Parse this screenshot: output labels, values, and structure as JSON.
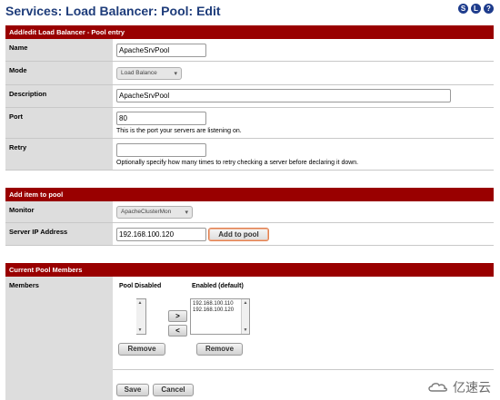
{
  "page": {
    "title": "Services: Load Balancer: Pool: Edit",
    "header_icons": [
      {
        "name": "status-icon",
        "glyph": "S"
      },
      {
        "name": "log-icon",
        "glyph": "L"
      },
      {
        "name": "help-icon",
        "glyph": "?"
      }
    ]
  },
  "colors": {
    "section_header": "#990000",
    "title": "#1e3c7a",
    "label_bg": "#dddddd"
  },
  "pool_entry": {
    "header": "Add/edit Load Balancer - Pool entry",
    "name": {
      "label": "Name",
      "value": "ApacheSrvPool"
    },
    "mode": {
      "label": "Mode",
      "value": "Load Balance"
    },
    "description": {
      "label": "Description",
      "value": "ApacheSrvPool"
    },
    "port": {
      "label": "Port",
      "value": "80",
      "hint": "This is the port your servers are listening on."
    },
    "retry": {
      "label": "Retry",
      "value": "",
      "hint": "Optionally specify how many times to retry checking a server before declaring it down."
    }
  },
  "add_item": {
    "header": "Add item to pool",
    "monitor": {
      "label": "Monitor",
      "value": "ApacheClusterMon"
    },
    "server_ip": {
      "label": "Server IP Address",
      "value": "192.168.100.120",
      "button": "Add to pool"
    }
  },
  "members": {
    "header": "Current Pool Members",
    "label": "Members",
    "disabled_title": "Pool Disabled",
    "enabled_title": "Enabled (default)",
    "disabled_items": [],
    "enabled_items": [
      "192.168.100.110",
      "192.168.100.120"
    ],
    "move_right": ">",
    "move_left": "<",
    "remove_label": "Remove"
  },
  "footer": {
    "save": "Save",
    "cancel": "Cancel"
  },
  "watermark": {
    "text": "亿速云"
  }
}
